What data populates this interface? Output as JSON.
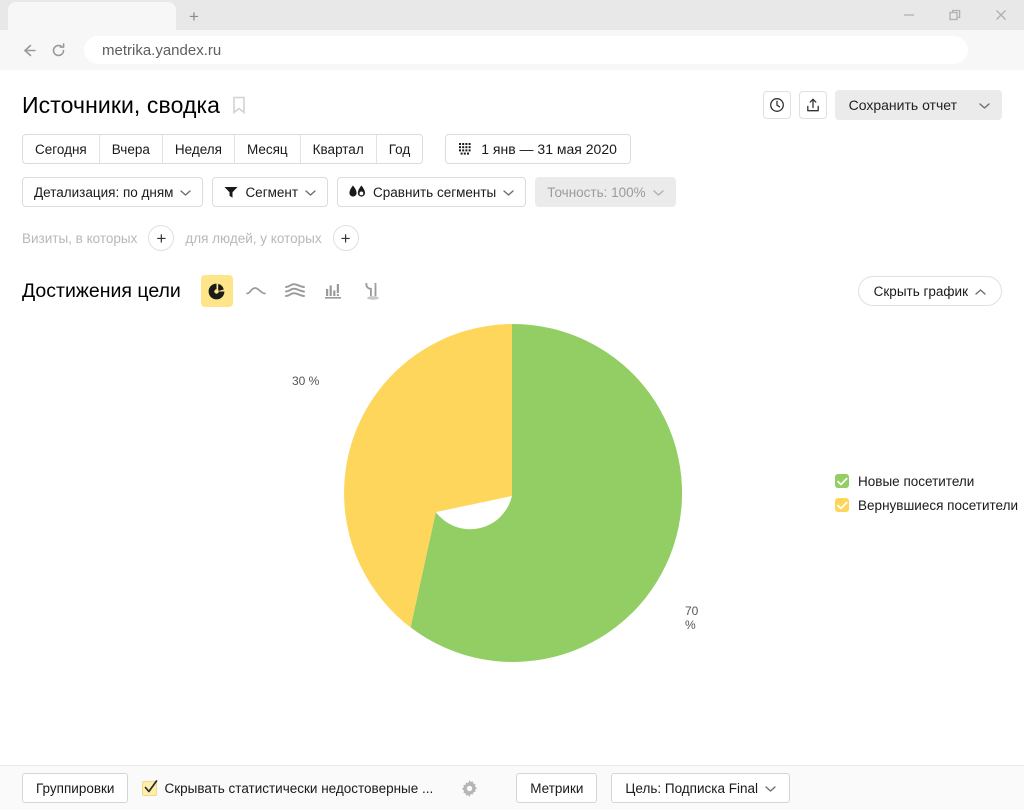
{
  "browser": {
    "url": "metrika.yandex.ru",
    "new_tab_label": "+",
    "back_icon": "back-arrow-icon",
    "reload_icon": "reload-icon",
    "minimize_label": "minimize",
    "maximize_label": "maximize",
    "close_label": "close"
  },
  "header": {
    "title": "Источники, сводка",
    "bookmark_icon": "bookmark-icon",
    "history_icon": "clock-icon",
    "export_icon": "share-upload-icon",
    "save_report_label": "Сохранить отчет"
  },
  "period_tabs": [
    {
      "label": "Сегодня"
    },
    {
      "label": "Вчера"
    },
    {
      "label": "Неделя"
    },
    {
      "label": "Месяц"
    },
    {
      "label": "Квартал"
    },
    {
      "label": "Год"
    }
  ],
  "date_range": {
    "icon": "calendar-icon",
    "value": "1 янв — 31 мая 2020"
  },
  "toolbar": {
    "detail_label": "Детализация: по дням",
    "segment_label": "Сегмент",
    "segment_icon": "funnel-icon",
    "compare_label": "Сравнить сегменты",
    "compare_icon": "compare-drops-icon",
    "accuracy_label": "Точность: 100%"
  },
  "filters": {
    "visits_label": "Визиты, в которых",
    "visits_add": "+",
    "people_label": "для людей, у которых",
    "people_add": "+"
  },
  "chart_header": {
    "title": "Достижения цели",
    "hide_chart_label": "Скрыть график",
    "types": [
      {
        "name": "pie-chart-icon",
        "active": true
      },
      {
        "name": "line-chart-icon",
        "active": false
      },
      {
        "name": "area-chart-icon",
        "active": false
      },
      {
        "name": "bar-chart-icon",
        "active": false
      },
      {
        "name": "map-chart-icon",
        "active": false
      }
    ]
  },
  "chart_data": {
    "type": "pie",
    "title": "Достижения цели",
    "donut": true,
    "categories": [
      "Новые посетители",
      "Вернувшиеся посетители"
    ],
    "values": [
      70,
      30
    ],
    "labels": [
      "70 %",
      "30 %"
    ],
    "colors": [
      "#92ce64",
      "#fdd65b"
    ],
    "legend_position": "right",
    "unit": "%"
  },
  "legend": [
    {
      "label": "Новые посетители",
      "color": "#92ce64"
    },
    {
      "label": "Вернувшиеся посетители",
      "color": "#fdd65b"
    }
  ],
  "footer": {
    "groupings_label": "Группировки",
    "hide_unreliable_label": "Скрывать статистически недостоверные ...",
    "settings_icon": "gear-icon",
    "metrics_label": "Метрики",
    "goal_label": "Цель: Подписка Final"
  }
}
